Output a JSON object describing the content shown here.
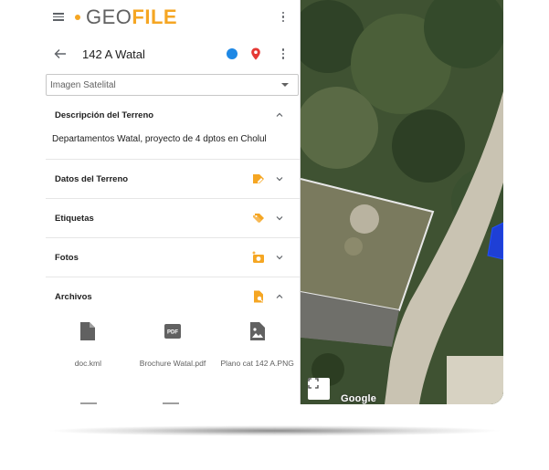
{
  "app": {
    "logo_prefix": "GEO",
    "logo_suffix": "FILE"
  },
  "header": {
    "title": "142 A Watal",
    "status_color": "#1e88e5",
    "pin_color": "#e53935"
  },
  "map_type": {
    "selected": "Imagen Satelital"
  },
  "sections": {
    "descripcion": {
      "title": "Descripción del Terreno",
      "text": "Departamentos Watal, proyecto de 4 dptos en Cholul",
      "expanded": true
    },
    "datos": {
      "title": "Datos del Terreno",
      "expanded": false
    },
    "etiquetas": {
      "title": "Etiquetas",
      "expanded": false
    },
    "fotos": {
      "title": "Fotos",
      "expanded": false
    },
    "archivos": {
      "title": "Archivos",
      "expanded": true
    }
  },
  "files": [
    {
      "name": "doc.kml",
      "type": "document"
    },
    {
      "name": "Brochure Watal.pdf",
      "type": "pdf",
      "badge": "PDF"
    },
    {
      "name": "Plano cat 142 A.PNG",
      "type": "image"
    }
  ],
  "map": {
    "attribution": "Google"
  },
  "colors": {
    "accent": "#f5a623",
    "icon_text": "#616161"
  }
}
